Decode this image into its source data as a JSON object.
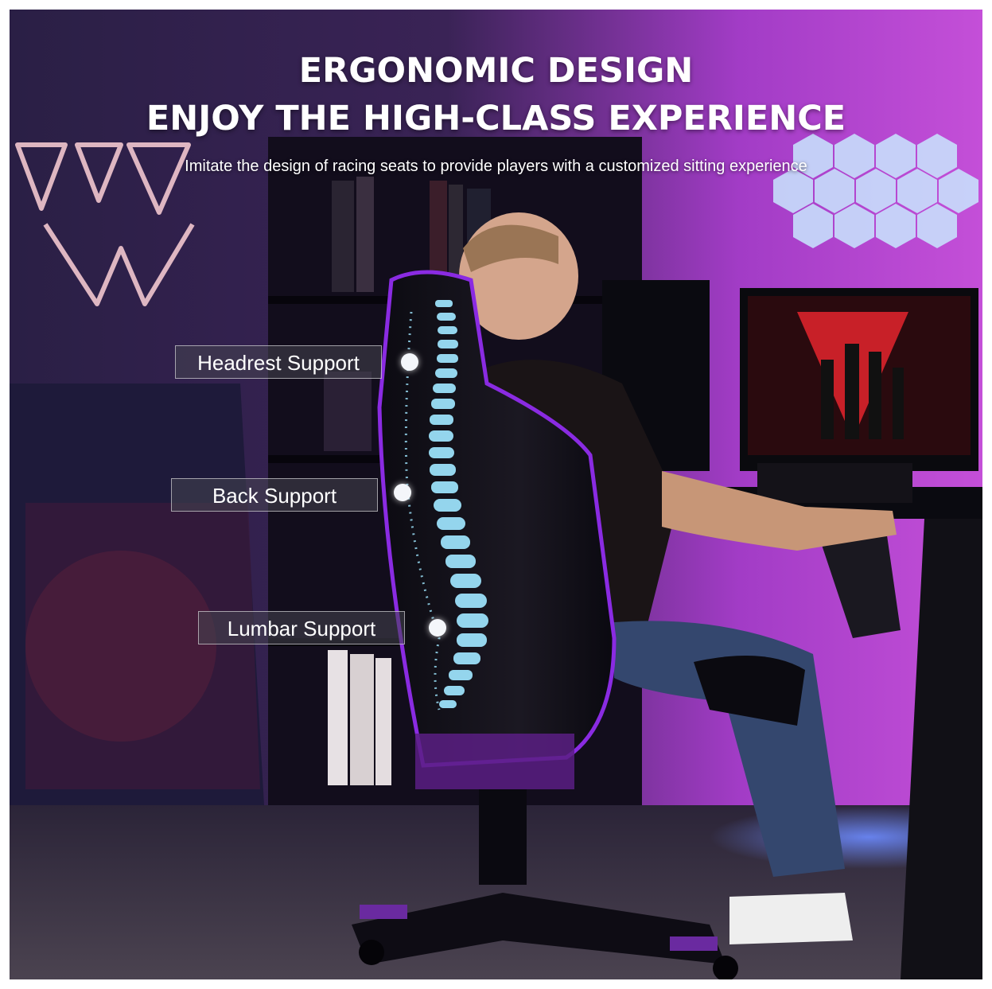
{
  "headline": {
    "line1": "ERGONOMIC DESIGN",
    "line2": "ENJOY THE HIGH-CLASS EXPERIENCE",
    "subtitle": "Imitate the design of racing seats to provide players with a customized sitting experience"
  },
  "callouts": [
    {
      "label": "Headrest Support"
    },
    {
      "label": "Back Support"
    },
    {
      "label": "Lumbar Support"
    }
  ],
  "colors": {
    "accent_purple": "#8a2be2",
    "spine_glow": "#9fe6ff",
    "wall_pink": "#b13ad0",
    "led_blue": "#4a6bff"
  }
}
